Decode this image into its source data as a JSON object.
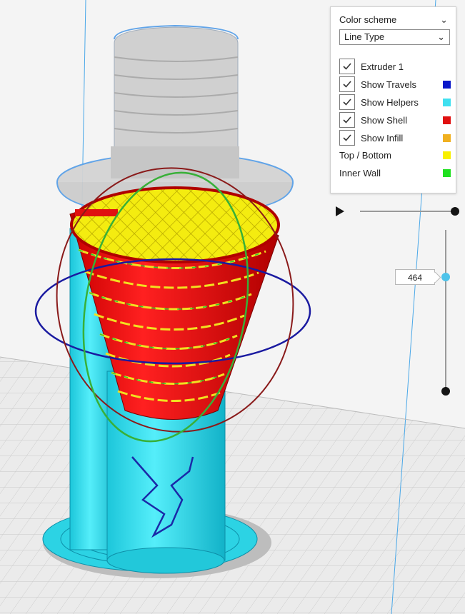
{
  "panel": {
    "title": "Color scheme",
    "selected_scheme": "Line Type",
    "checkboxes": [
      {
        "label": "Extruder 1",
        "checked": true,
        "color": ""
      },
      {
        "label": "Show Travels",
        "checked": true,
        "color": "#0a17c9"
      },
      {
        "label": "Show Helpers",
        "checked": true,
        "color": "#3fe0f0"
      },
      {
        "label": "Show Shell",
        "checked": true,
        "color": "#e01010"
      },
      {
        "label": "Show Infill",
        "checked": true,
        "color": "#f0b020"
      }
    ],
    "legend": [
      {
        "label": "Top / Bottom",
        "color": "#f8f000"
      },
      {
        "label": "Inner Wall",
        "color": "#20e020"
      }
    ]
  },
  "layer_slider": {
    "value": "464"
  },
  "icons": {
    "title_chevron": "chevron-down-icon",
    "select_chevron": "chevron-down-icon",
    "check": "checkmark-icon",
    "play": "play-icon"
  }
}
